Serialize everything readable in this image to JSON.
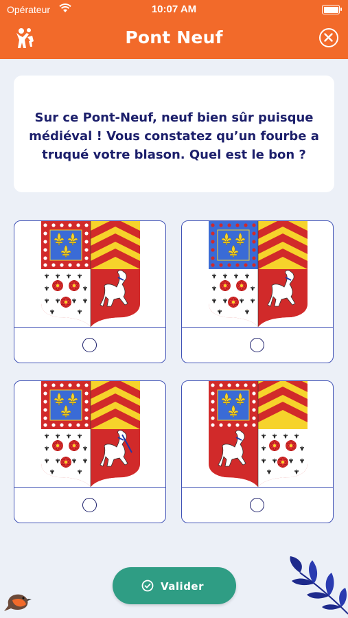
{
  "status_bar": {
    "carrier": "Opérateur",
    "time": "10:07 AM",
    "battery_level": 1.0
  },
  "header": {
    "title": "Pont Neuf",
    "logo_icon": "family-app-logo-icon",
    "close_icon": "close-icon",
    "color": "#f26a2a"
  },
  "question": {
    "text": "Sur ce Pont-Neuf, neuf bien sûr  puisque médiéval ! Vous constatez qu’un fourbe a truqué votre blason. Quel est le bon ?"
  },
  "options": [
    {
      "image": "coat-of-arms-option-1",
      "border_style": "red-with-white-dots",
      "selected": false
    },
    {
      "image": "coat-of-arms-option-2",
      "border_style": "blue-with-red-dots",
      "selected": false
    },
    {
      "image": "coat-of-arms-option-3",
      "border_style": "red-with-white-dots",
      "selected": false
    },
    {
      "image": "coat-of-arms-option-4",
      "border_style": "red-with-white-dots",
      "selected": false
    }
  ],
  "validate_button": {
    "label": "Valider",
    "icon": "check-circle-icon",
    "color": "#2f9d84"
  },
  "colors": {
    "accent": "#f26a2a",
    "text_dark": "#1c1f6b",
    "option_border": "#3f51b5",
    "background": "#ecf0f7"
  }
}
